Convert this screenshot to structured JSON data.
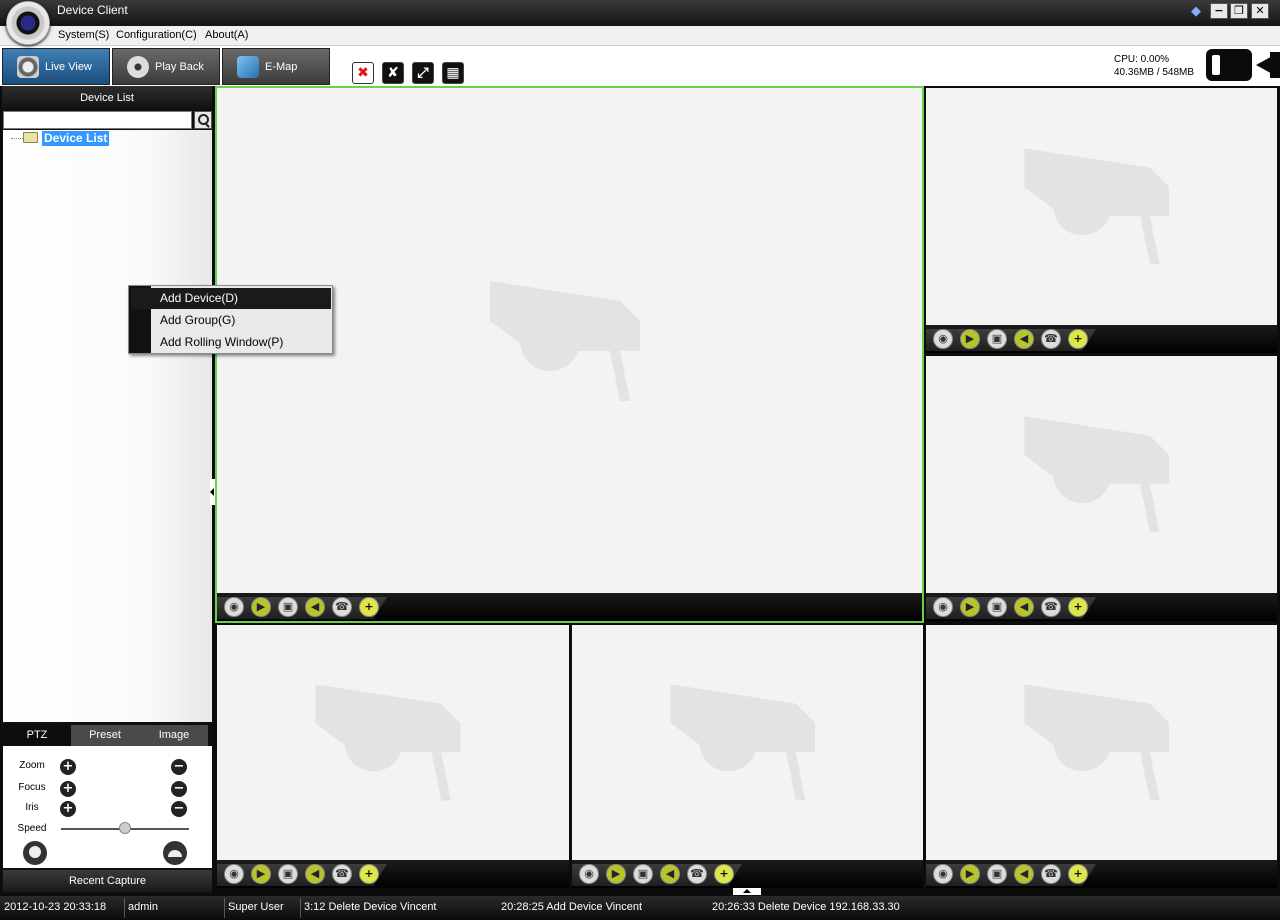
{
  "window": {
    "title": "Device Client",
    "controls": {
      "minimize": "−",
      "maximize": "❐",
      "close": "✕"
    }
  },
  "menu": {
    "items": [
      {
        "label": "System(S)"
      },
      {
        "label": "Configuration(C)"
      },
      {
        "label": "About(A)"
      }
    ]
  },
  "tabs": [
    {
      "label": "Live View",
      "icon": "camera-icon",
      "active": true
    },
    {
      "label": "Play Back",
      "icon": "film-reel-icon",
      "active": false
    },
    {
      "label": "E-Map",
      "icon": "map-icon",
      "active": false
    }
  ],
  "toolbar": {
    "buttons": [
      {
        "name": "close-all-icon"
      },
      {
        "name": "tools-icon"
      },
      {
        "name": "fullscreen-icon"
      },
      {
        "name": "layout-icon"
      }
    ]
  },
  "system_stats": {
    "cpu": "CPU: 0.00%",
    "memory": "40.36MB / 548MB"
  },
  "device_list": {
    "header": "Device List",
    "search_value": "",
    "tree_root": "Device List"
  },
  "context_menu": {
    "items": [
      {
        "label": "Add Device(D)",
        "highlighted": true
      },
      {
        "label": "Add Group(G)",
        "highlighted": false
      },
      {
        "label": "Add Rolling Window(P)",
        "highlighted": false
      }
    ]
  },
  "ptz": {
    "tabs": [
      {
        "label": "PTZ",
        "active": true
      },
      {
        "label": "Preset",
        "active": false
      },
      {
        "label": "Image",
        "active": false
      }
    ],
    "controls": [
      {
        "label": "Zoom"
      },
      {
        "label": "Focus"
      },
      {
        "label": "Iris"
      }
    ],
    "speed_label": "Speed",
    "speed_value": 0.5,
    "recent_capture": "Recent Capture"
  },
  "video_windows": {
    "count": 6,
    "selected_index": 0,
    "toolbar_icons": [
      "webcam-icon",
      "record-icon",
      "snapshot-icon",
      "audio-icon",
      "intercom-icon",
      "zoom-in-icon"
    ]
  },
  "status_bar": {
    "datetime": "2012-10-23 20:33:18",
    "user": "admin",
    "role": "Super User",
    "log": [
      "3:12 Delete Device Vincent",
      "20:28:25 Add Device Vincent",
      "20:26:33 Delete Device 192.168.33.30"
    ]
  },
  "colors": {
    "selection_border": "#6ad14a",
    "active_tab": "#2c6aa3",
    "tree_selection": "#3399ff"
  }
}
